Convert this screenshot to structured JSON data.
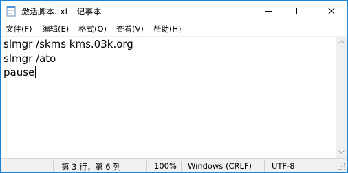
{
  "window": {
    "title": "激活脚本.txt - 记事本"
  },
  "menu": {
    "file": "文件(F)",
    "edit": "编辑(E)",
    "format": "格式(O)",
    "view": "查看(V)",
    "help": "帮助(H)"
  },
  "editor": {
    "lines": [
      "slmgr /skms kms.03k.org",
      "slmgr /ato",
      "pause"
    ]
  },
  "status": {
    "position": "第 3 行，第 6 列",
    "zoom": "100%",
    "line_ending": "Windows (CRLF)",
    "encoding": "UTF-8"
  },
  "icons": {
    "app": "notepad-icon",
    "minimize": "minimize-icon",
    "maximize": "maximize-icon",
    "close": "close-icon",
    "scroll_up": "chevron-up-icon",
    "scroll_down": "chevron-down-icon",
    "grip": "resize-grip-icon"
  },
  "colors": {
    "window_border": "#1883d7",
    "statusbar_bg": "#f0f0f0",
    "scrollbar_bg": "#f0f0f0",
    "text": "#000000"
  }
}
